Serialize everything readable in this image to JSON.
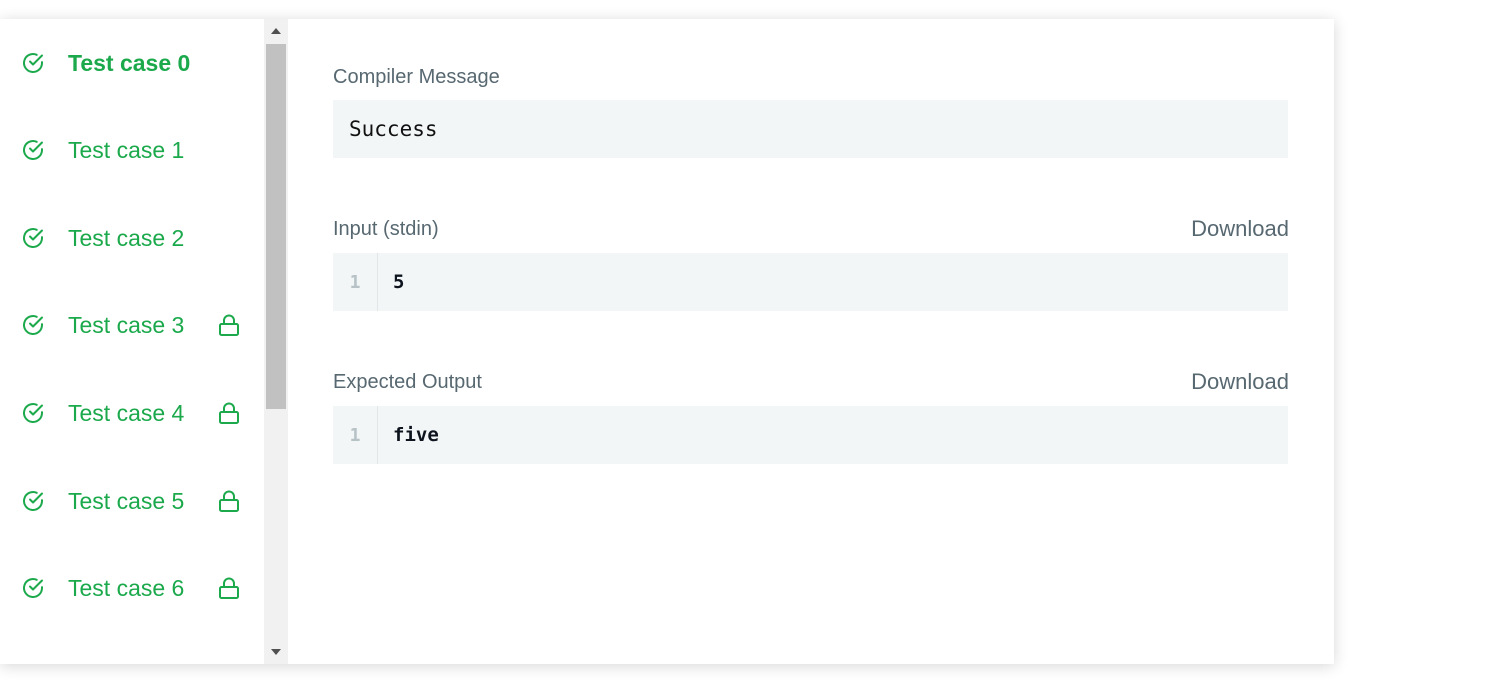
{
  "colors": {
    "accent": "#1ba94c",
    "label": "#576871",
    "code_bg": "#f3f6f7"
  },
  "test_cases": [
    {
      "label": "Test case 0",
      "status_icon": "check-circle-icon",
      "locked": false,
      "active": true
    },
    {
      "label": "Test case 1",
      "status_icon": "check-circle-icon",
      "locked": false,
      "active": false
    },
    {
      "label": "Test case 2",
      "status_icon": "check-circle-icon",
      "locked": false,
      "active": false
    },
    {
      "label": "Test case 3",
      "status_icon": "check-circle-icon",
      "locked": true,
      "active": false
    },
    {
      "label": "Test case 4",
      "status_icon": "check-circle-icon",
      "locked": true,
      "active": false
    },
    {
      "label": "Test case 5",
      "status_icon": "check-circle-icon",
      "locked": true,
      "active": false
    },
    {
      "label": "Test case 6",
      "status_icon": "check-circle-icon",
      "locked": true,
      "active": false
    }
  ],
  "compiler": {
    "label": "Compiler Message",
    "message": "Success"
  },
  "input": {
    "label": "Input (stdin)",
    "download": "Download",
    "line_number": "1",
    "content": "5"
  },
  "expected": {
    "label": "Expected Output",
    "download": "Download",
    "line_number": "1",
    "content": "five"
  }
}
